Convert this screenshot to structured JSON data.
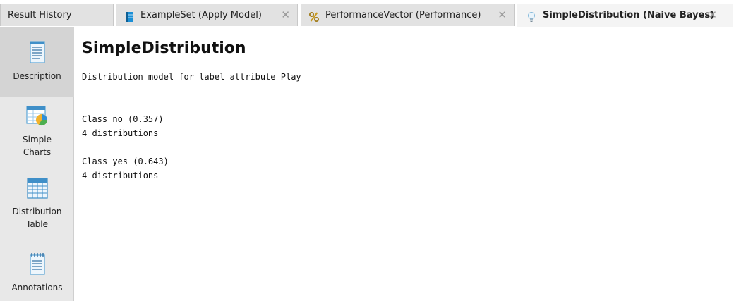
{
  "tabs": [
    {
      "label": "Result History",
      "closable": false
    },
    {
      "label": "ExampleSet (Apply Model)",
      "icon": "table-icon",
      "closable": true
    },
    {
      "label": "PerformanceVector (Performance)",
      "icon": "percent-icon",
      "closable": true
    },
    {
      "label": "SimpleDistribution (Naive Bayes)",
      "icon": "lightbulb-icon",
      "closable": true,
      "active": true
    }
  ],
  "close_glyph": "✕",
  "sidebar": {
    "items": [
      {
        "label": "Description",
        "icon": "document-icon",
        "active": true
      },
      {
        "label_line1": "Simple",
        "label_line2": "Charts",
        "icon": "chart-icon"
      },
      {
        "label_line1": "Distribution",
        "label_line2": "Table",
        "icon": "grid-table-icon"
      },
      {
        "label": "Annotations",
        "icon": "notes-icon"
      }
    ]
  },
  "main": {
    "title": "SimpleDistribution",
    "description": "Distribution model for label attribute Play",
    "classes": [
      {
        "header": "Class no (0.357)",
        "detail": "4 distributions"
      },
      {
        "header": "Class yes (0.643)",
        "detail": "4 distributions"
      }
    ]
  },
  "colors": {
    "accent": "#1b8fd6",
    "sidebar_bg": "#e8e8e8",
    "active_item": "#d4d4d4"
  }
}
